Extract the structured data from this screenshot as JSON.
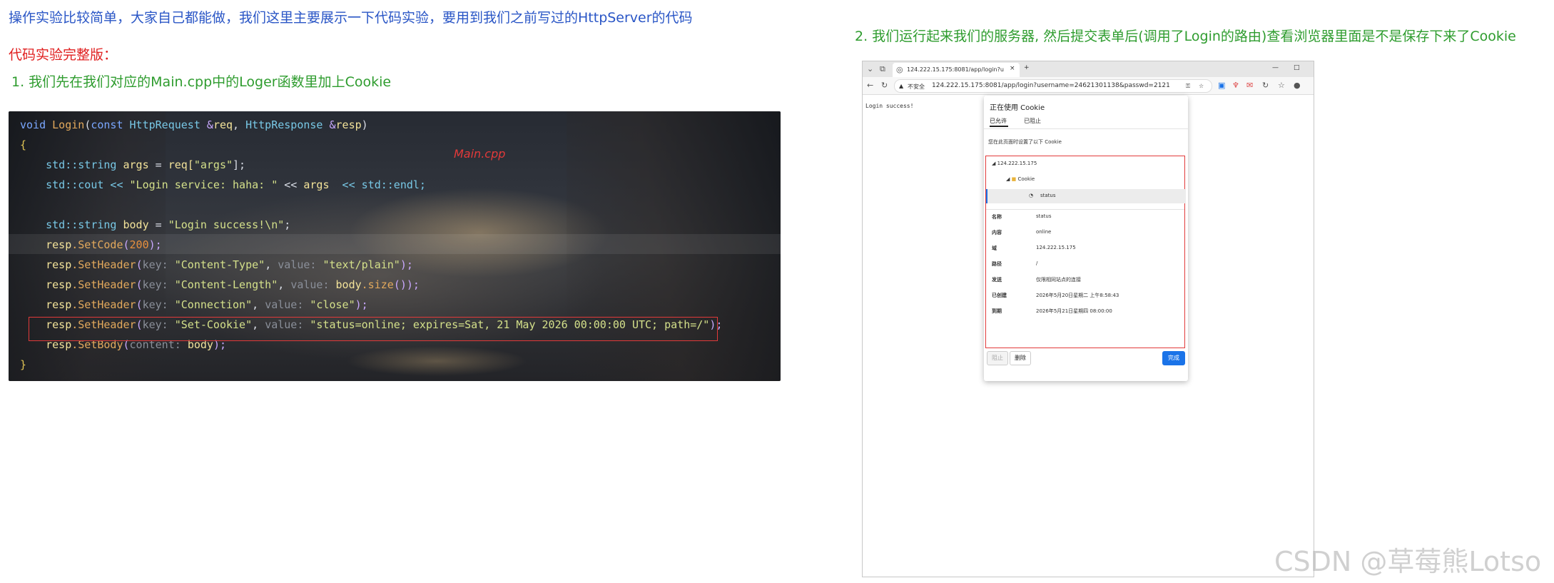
{
  "intro": "操作实验比较简单，大家自己都能做，我们这里主要展示一下代码实验，要用到我们之前写过的HttpServer的代码",
  "section_title": "代码实验完整版：",
  "step1": "1. 我们先在我们对应的Main.cpp中的Loger函数里加上Cookie",
  "step2": "2. 我们运行起来我们的服务器, 然后提交表单后(调用了Login的路由)查看浏览器里面是不是保存下来了Cookie",
  "code": {
    "file_label": "Main.cpp",
    "lines": {
      "l1_kw": "void",
      "l1_fn": "Login",
      "l1_rest_a": "(",
      "l1_const": "const",
      "l1_t1": "HttpRequest",
      "l1_amp1": " &",
      "l1_p1": "req",
      "l1_comma": ", ",
      "l1_t2": "HttpResponse",
      "l1_amp2": " &",
      "l1_p2": "resp",
      "l1_close": ")",
      "l2": "{",
      "l3_a": "    std::string ",
      "l3_v": "args",
      "l3_b": " = ",
      "l3_c": "req[",
      "l3_s": "\"args\"",
      "l3_d": "];",
      "l4_a": "    std::cout << ",
      "l4_s": "\"Login service: haha: \"",
      "l4_b": " << ",
      "l4_v": "args",
      "l4_c": "  << std::endl;",
      "l6_a": "    std::string ",
      "l6_v": "body",
      "l6_b": " = ",
      "l6_s": "\"Login success!\\n\"",
      "l6_c": ";",
      "l7_a": "    ",
      "l7_obj": "resp",
      "l7_m": ".SetCode",
      "l7_b": "(",
      "l7_n": "200",
      "l7_c": ");",
      "l8_a": "    ",
      "l8_obj": "resp",
      "l8_m": ".SetHeader",
      "l8_b": "(",
      "l8_h1": "key: ",
      "l8_s1": "\"Content-Type\"",
      "l8_c": ", ",
      "l8_h2": "value: ",
      "l8_s2": "\"text/plain\"",
      "l8_d": ");",
      "l9_a": "    ",
      "l9_obj": "resp",
      "l9_m": ".SetHeader",
      "l9_b": "(",
      "l9_h1": "key: ",
      "l9_s1": "\"Content-Length\"",
      "l9_c": ", ",
      "l9_h2": "value: ",
      "l9_v": "body",
      "l9_m2": ".size",
      "l9_d": "());",
      "l10_a": "    ",
      "l10_obj": "resp",
      "l10_m": ".SetHeader",
      "l10_b": "(",
      "l10_h1": "key: ",
      "l10_s1": "\"Connection\"",
      "l10_c": ", ",
      "l10_h2": "value: ",
      "l10_s2": "\"close\"",
      "l10_d": ");",
      "l11_a": "    ",
      "l11_obj": "resp",
      "l11_m": ".SetHeader",
      "l11_b": "(",
      "l11_h1": "key: ",
      "l11_s1": "\"Set-Cookie\"",
      "l11_c": ", ",
      "l11_h2": "value: ",
      "l11_s2": "\"status=online; expires=Sat, 21 May 2026 00:00:00 UTC; path=/\"",
      "l11_d": ");",
      "l12_a": "    ",
      "l12_obj": "resp",
      "l12_m": ".SetBody",
      "l12_b": "(",
      "l12_h1": "content: ",
      "l12_v": "body",
      "l12_d": ");",
      "l13": "}"
    }
  },
  "browser": {
    "tab_title": "124.222.15.175:8081/app/login?u",
    "tab_close": "×",
    "new_tab": "+",
    "win_min": "—",
    "win_max": "□",
    "insecure_label": "不安全",
    "url": "124.222.15.175:8081/app/login?username=24621301138&passwd=2121",
    "page_text": "Login success!",
    "popup": {
      "title": "正在使用 Cookie",
      "tab_allowed": "已允许",
      "tab_blocked": "已阻止",
      "desc": "您在此页面时设置了以下 Cookie",
      "tree_host": "124.222.15.175",
      "tree_folder": "Cookie",
      "tree_item": "status",
      "details": [
        {
          "k": "名称",
          "v": "status"
        },
        {
          "k": "内容",
          "v": "online"
        },
        {
          "k": "域",
          "v": "124.222.15.175"
        },
        {
          "k": "路径",
          "v": "/"
        },
        {
          "k": "发送",
          "v": "仅限相同站点的连接"
        },
        {
          "k": "已创建",
          "v": "2026年5月20日星期二 上午8:58:43"
        },
        {
          "k": "到期",
          "v": "2026年5月21日星期四 08:00:00"
        }
      ],
      "btn_block": "阻止",
      "btn_delete": "删除",
      "btn_done": "完成"
    }
  },
  "watermark": "CSDN @草莓熊Lotso",
  "colors": {
    "accent_blue": "#1a73e8",
    "highlight_red": "#e23a3a"
  }
}
